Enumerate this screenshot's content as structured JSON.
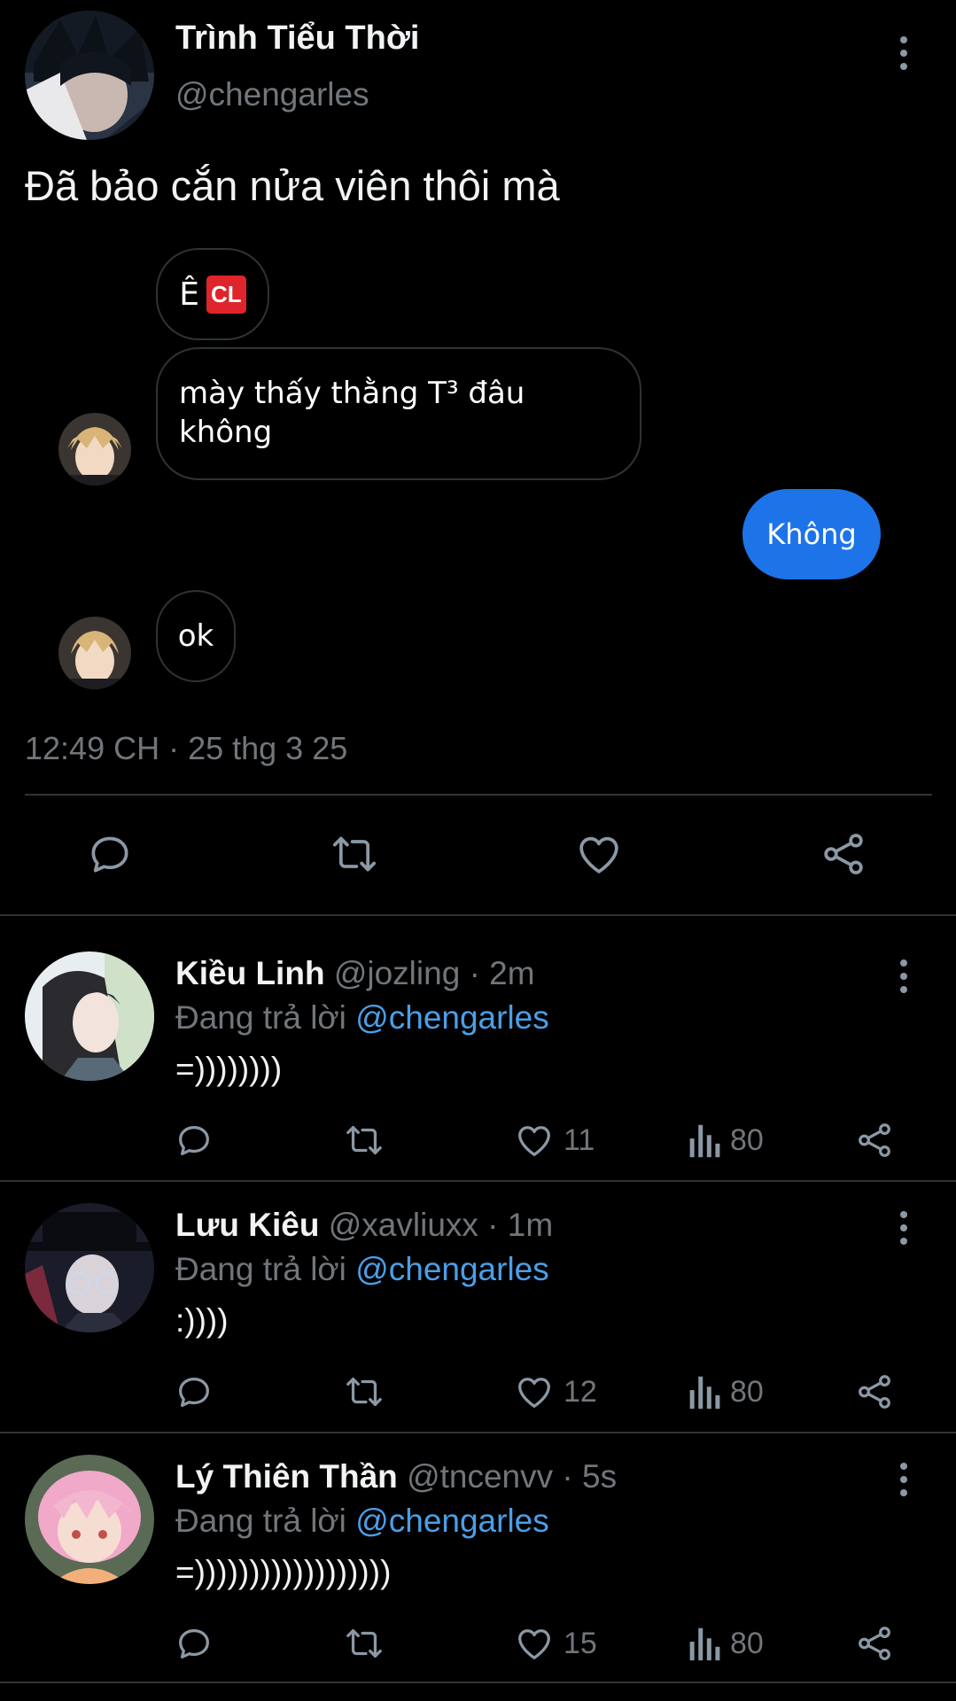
{
  "post": {
    "author_name": "Trình Tiểu Thời",
    "author_handle": "@chengarles",
    "text": "Đã bảo cắn nửa viên thôi mà",
    "chat": {
      "bubble1_prefix": "Ê",
      "bubble1_badge": "CL",
      "bubble2_line1": "mày thấy thằng T³ đâu",
      "bubble2_line2": "không",
      "bubble3": "Không",
      "bubble4": "ok"
    },
    "timestamp": "12:49 CH · 25 thg 3 25"
  },
  "replies": [
    {
      "name": "Kiều Linh",
      "handle": "@jozling",
      "time": "· 2m",
      "replying_to_label": "Đang trả lời",
      "replying_to_handle": "@chengarles",
      "text": "=))))))))",
      "likes": "11",
      "views": "80"
    },
    {
      "name": "Lưu Kiêu",
      "handle": "@xavliuxx",
      "time": "· 1m",
      "replying_to_label": "Đang trả lời",
      "replying_to_handle": "@chengarles",
      "text": ":))))",
      "likes": "12",
      "views": "80"
    },
    {
      "name": "Lý Thiên Thần",
      "handle": "@tncenvv",
      "time": "· 5s",
      "replying_to_label": "Đang trả lời",
      "replying_to_handle": "@chengarles",
      "text": "=))))))))))))))))))",
      "likes": "15",
      "views": "80"
    }
  ],
  "colors": {
    "background": "#000000",
    "accent_blue": "#1d74e8",
    "link_blue": "#4a9fe8",
    "muted": "#71767b",
    "badge_red": "#e0242b"
  },
  "icons": [
    "more-vertical-icon",
    "reply-icon",
    "retweet-icon",
    "like-icon",
    "views-icon",
    "share-icon"
  ]
}
